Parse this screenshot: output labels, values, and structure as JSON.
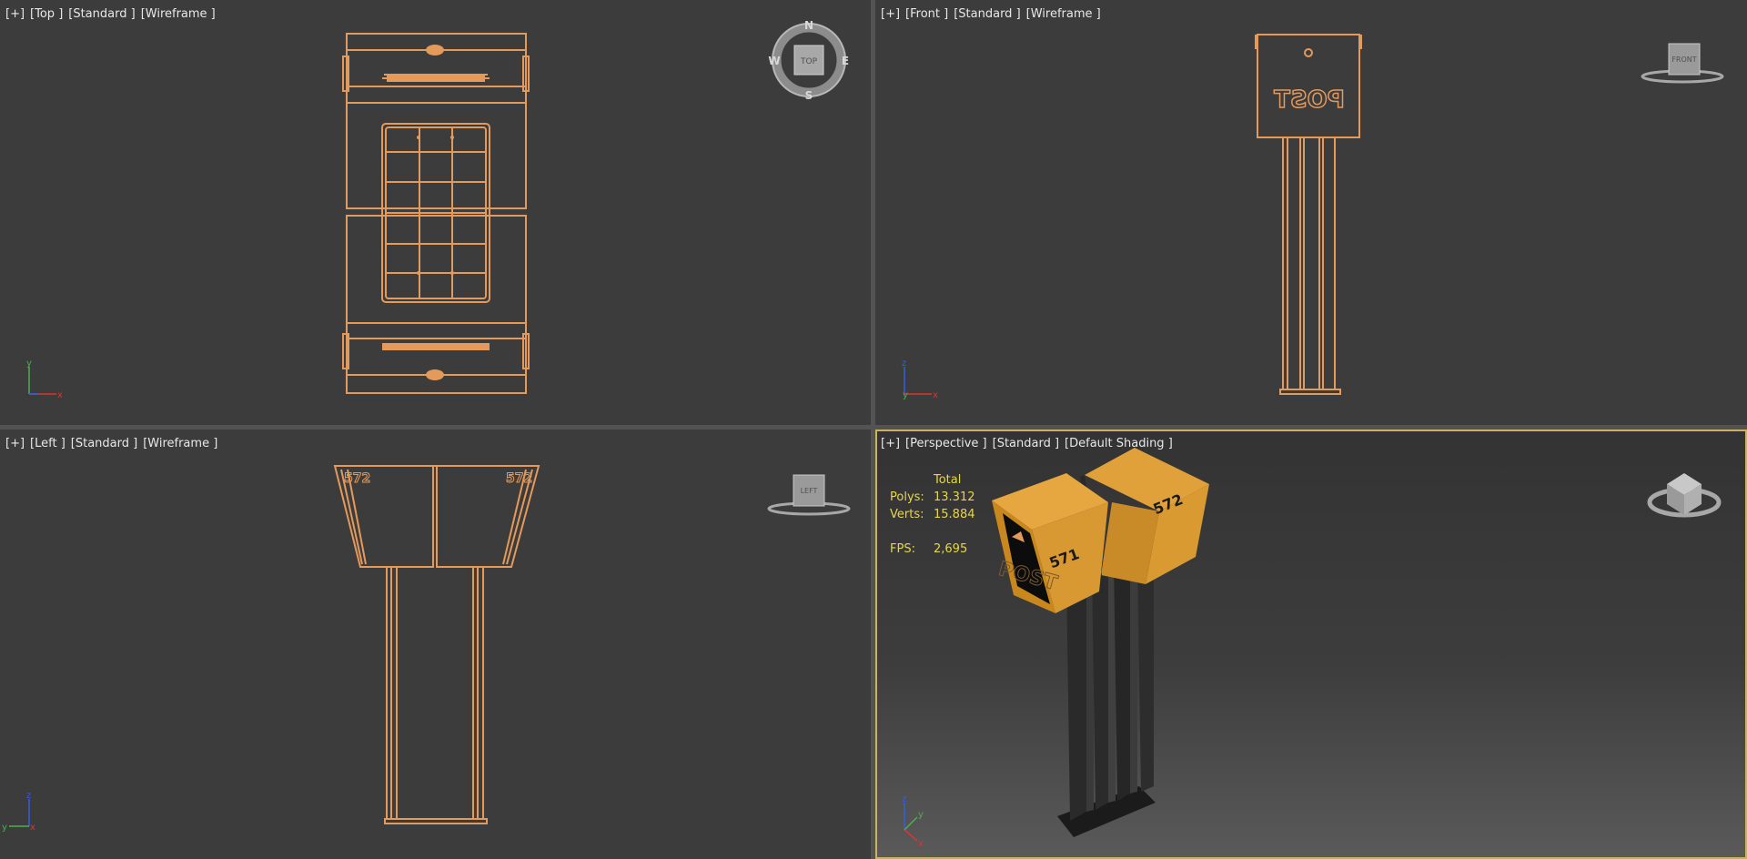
{
  "viewports": {
    "top": {
      "labels": [
        "[+]",
        "[Top ]",
        "[Standard ]",
        "[Wireframe ]"
      ],
      "cube": "TOP",
      "compass": {
        "n": "N",
        "s": "S",
        "e": "E",
        "w": "W"
      },
      "axes": {
        "v": "y",
        "h": "x"
      }
    },
    "front": {
      "labels": [
        "[+]",
        "[Front ]",
        "[Standard ]",
        "[Wireframe ]"
      ],
      "cube": "FRONT",
      "sign": "POST",
      "axes": {
        "v": "z",
        "h": "x",
        "c": "y"
      }
    },
    "left": {
      "labels": [
        "[+]",
        "[Left ]",
        "[Standard ]",
        "[Wireframe ]"
      ],
      "cube": "LEFT",
      "numbers": [
        "572",
        "572"
      ],
      "axes": {
        "v": "z",
        "h": "y",
        "c": "x"
      }
    },
    "persp": {
      "labels": [
        "[+]",
        "[Perspective ]",
        "[Standard ]",
        "[Default Shading ]"
      ],
      "stats": {
        "title": "Total",
        "polys_label": "Polys:",
        "polys": "13.312",
        "verts_label": "Verts:",
        "verts": "15.884",
        "fps_label": "FPS:",
        "fps": "2,695"
      },
      "box_numbers": [
        "571",
        "572"
      ],
      "sign": "POST",
      "axes": {
        "v": "z",
        "h": "x",
        "c": "y"
      }
    }
  },
  "colors": {
    "wire": "#e39a5a",
    "bg": "#3c3c3c",
    "border": "#535353",
    "active": "#c8b45a",
    "box": "#e2a23c",
    "stat": "#e7d64a"
  }
}
